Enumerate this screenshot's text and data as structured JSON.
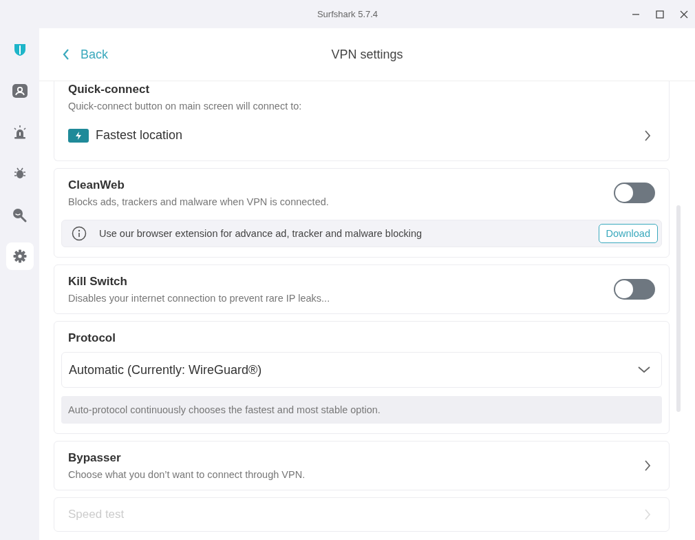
{
  "window": {
    "title": "Surfshark 5.7.4"
  },
  "sidebar": {
    "items": [
      {
        "kind": "shield",
        "selected": false
      },
      {
        "kind": "person",
        "selected": false
      },
      {
        "kind": "alarm",
        "selected": false
      },
      {
        "kind": "bug",
        "selected": false
      },
      {
        "kind": "search",
        "selected": false
      },
      {
        "kind": "gear",
        "selected": true
      }
    ]
  },
  "header": {
    "back": "Back",
    "title": "VPN settings"
  },
  "sections": [
    {
      "kind": "quick_connect",
      "title": "Quick-connect",
      "description": "Quick-connect button on main screen will connect to:",
      "option": "Fastest location"
    },
    {
      "kind": "toggle",
      "title": "CleanWeb",
      "description": "Blocks ads, trackers and malware when VPN is connected.",
      "on": false,
      "notice": "Use our browser extension for advance ad, tracker and malware blocking",
      "button": "Download"
    },
    {
      "kind": "toggle",
      "title": "Kill Switch",
      "description": "Disables your internet connection to prevent rare IP leaks...",
      "on": false
    },
    {
      "kind": "dropdown",
      "title": "Protocol",
      "value": "Automatic (Currently: WireGuard®)",
      "note": "Auto-protocol continuously chooses the fastest and most stable option."
    },
    {
      "kind": "link",
      "title": "Bypasser",
      "description": "Choose what you don’t want to connect through VPN.",
      "disabled": false
    },
    {
      "kind": "link",
      "title": "Speed test",
      "disabled": true
    }
  ]
}
